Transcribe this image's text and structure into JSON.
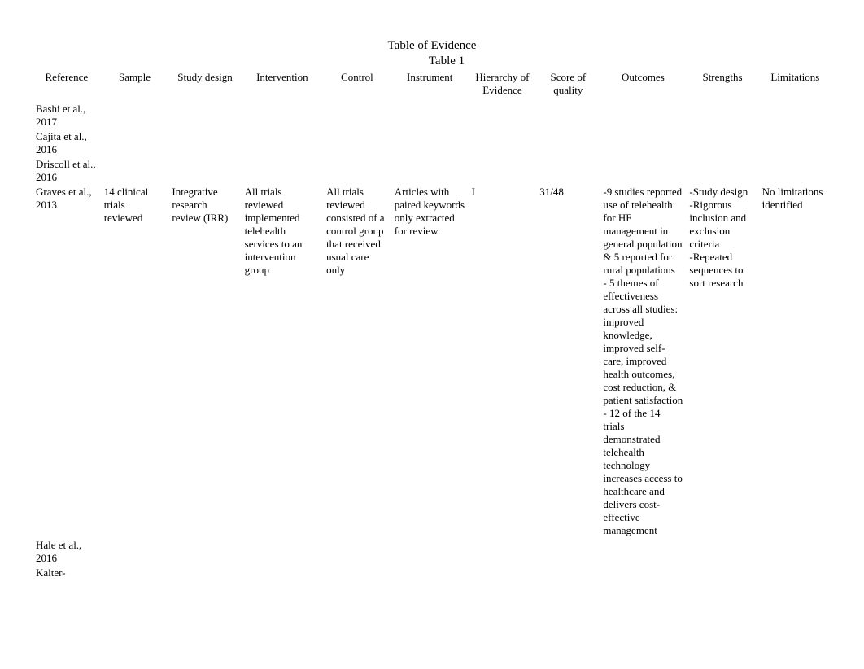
{
  "title": "Table of Evidence",
  "subtitle": "Table 1",
  "headers": {
    "reference": "Reference",
    "sample": "Sample",
    "studydesign": "Study design",
    "intervention": "Intervention",
    "control": "Control",
    "instrument": "Instrument",
    "hierarchy": "Hierarchy of Evidence",
    "score": "Score of quality",
    "outcomes": "Outcomes",
    "strengths": "Strengths",
    "limitations": "Limitations"
  },
  "rows": [
    {
      "reference": "Bashi et al., 2017",
      "sample": "",
      "studydesign": "",
      "intervention": "",
      "control": "",
      "instrument": "",
      "hierarchy": "",
      "score": "",
      "outcomes": "",
      "strengths": "",
      "limitations": ""
    },
    {
      "reference": "Cajita et al., 2016",
      "sample": "",
      "studydesign": "",
      "intervention": "",
      "control": "",
      "instrument": "",
      "hierarchy": "",
      "score": "",
      "outcomes": "",
      "strengths": "",
      "limitations": ""
    },
    {
      "reference": "Driscoll et al., 2016",
      "sample": "",
      "studydesign": "",
      "intervention": "",
      "control": "",
      "instrument": "",
      "hierarchy": "",
      "score": "",
      "outcomes": "",
      "strengths": "",
      "limitations": ""
    },
    {
      "reference": "Graves et al., 2013",
      "sample": "14 clinical trials reviewed",
      "studydesign": "Integrative research review (IRR)",
      "intervention": "All trials reviewed implemented telehealth services to an intervention group",
      "control": "All trials reviewed consisted of a control group that received usual care only",
      "instrument": "Articles with paired keywords only extracted for review",
      "hierarchy": "I",
      "score": "31/48",
      "outcomes": "-9 studies reported use of telehealth for HF management in general population & 5 reported for rural populations\n- 5 themes of effectiveness across all studies: improved knowledge, improved self-care, improved health outcomes, cost reduction, & patient satisfaction\n- 12 of the 14 trials demonstrated telehealth technology increases access to healthcare and delivers cost-effective management",
      "strengths": "-Study design\n-Rigorous inclusion and exclusion criteria\n-Repeated sequences to sort research",
      "limitations": "No limitations identified"
    },
    {
      "reference": "Hale et al., 2016",
      "sample": "",
      "studydesign": "",
      "intervention": "",
      "control": "",
      "instrument": "",
      "hierarchy": "",
      "score": "",
      "outcomes": "",
      "strengths": "",
      "limitations": ""
    },
    {
      "reference": "Kalter-",
      "sample": "",
      "studydesign": "",
      "intervention": "",
      "control": "",
      "instrument": "",
      "hierarchy": "",
      "score": "",
      "outcomes": "",
      "strengths": "",
      "limitations": ""
    }
  ]
}
